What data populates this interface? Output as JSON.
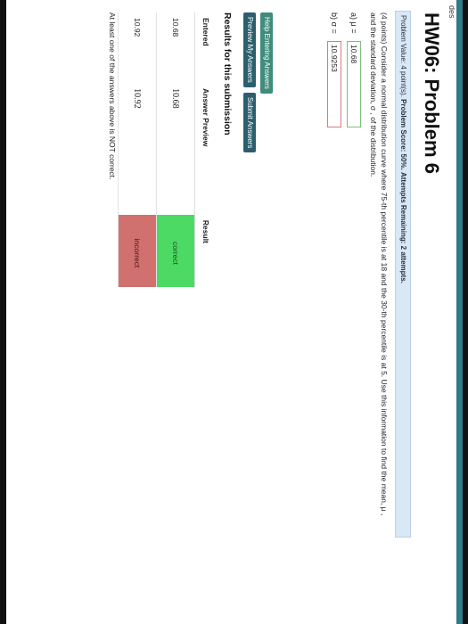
{
  "breadcrumb": "des",
  "page": {
    "title": "HW06: Problem 6"
  },
  "info": {
    "problem_value": "Problem Value: 4 point(s).",
    "problem_score": "Problem Score: 50%.",
    "attempts": "Attempts Remaining: 2 attempts."
  },
  "problem": {
    "text": "(4 points) Consider a normal distribution curve where 75-th percentile is at 18 and the 30-th percentile is at 5. Use this information to find the mean, μ , and the standard deviation, σ , of the distribution."
  },
  "answers": [
    {
      "label": "a) μ =",
      "value": "10.68"
    },
    {
      "label": "b) σ =",
      "value": "10.9253"
    }
  ],
  "buttons": {
    "help": "Help Entering Answers",
    "preview": "Preview My Answers",
    "submit": "Submit Answers"
  },
  "results": {
    "title": "Results for this submission",
    "headers": [
      "Entered",
      "Answer Preview",
      "Result"
    ],
    "rows": [
      {
        "entered": "10.68",
        "preview": "10.68",
        "result": "correct"
      },
      {
        "entered": "10.92",
        "preview": "10.92",
        "result": "incorrect"
      }
    ],
    "note": "At least one of the answers above is NOT correct."
  },
  "colors": {
    "correct": "#4cd964",
    "incorrect": "#d0706f",
    "accent": "#2b5f6d"
  }
}
